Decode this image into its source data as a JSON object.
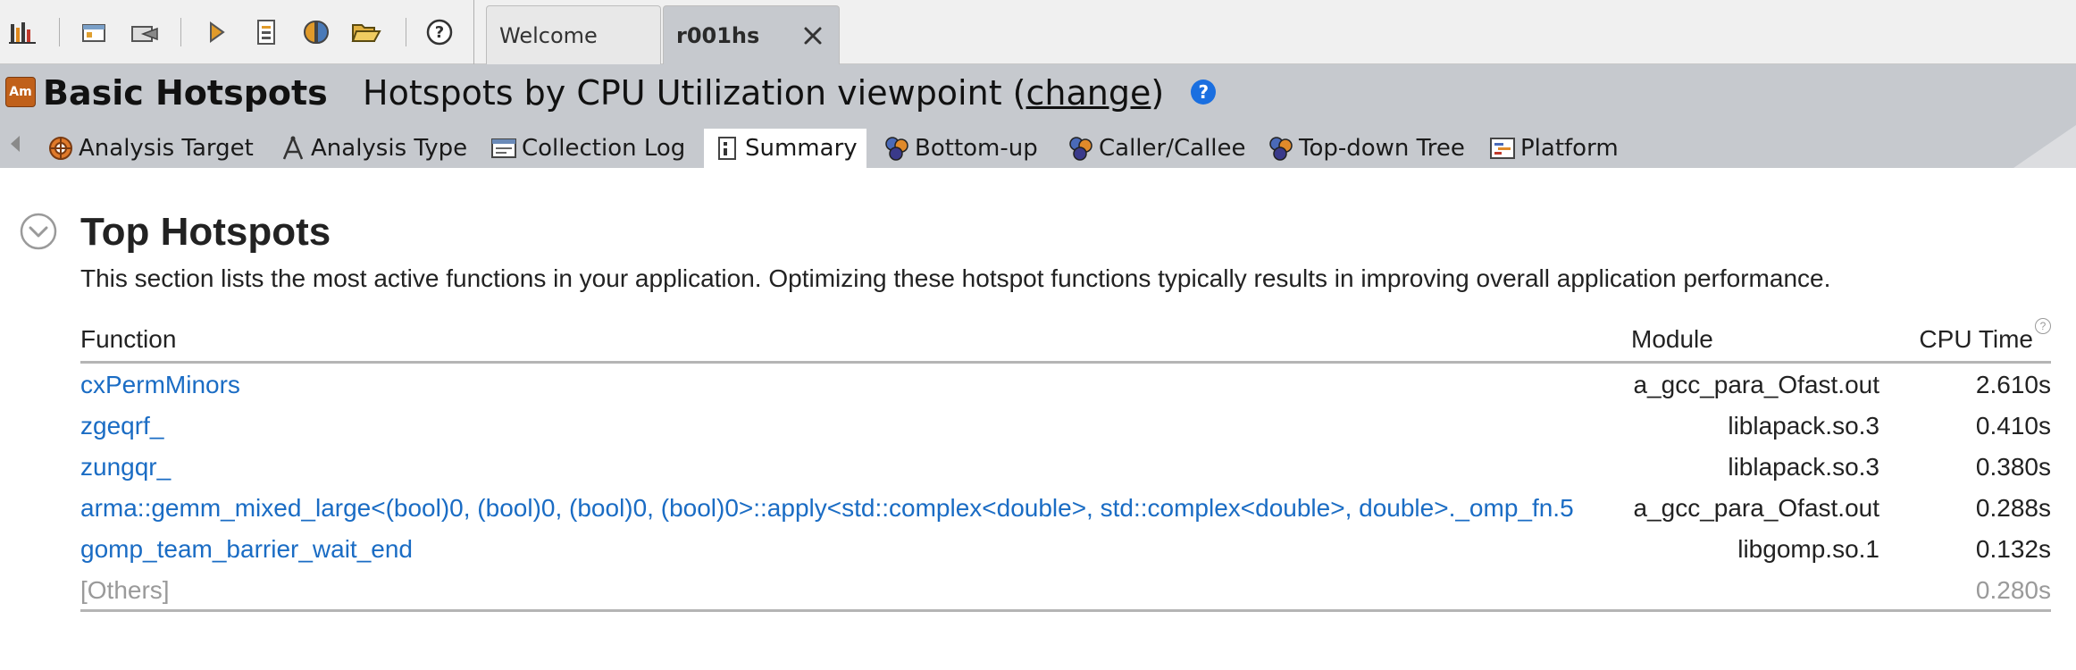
{
  "toolbar": {
    "icons": [
      "project-navigator-icon",
      "new-project-icon",
      "open-project-icon",
      "new-analysis-icon",
      "open-result-icon",
      "compare-results-icon",
      "open-file-icon",
      "help-icon"
    ]
  },
  "doc_tabs": [
    {
      "label": "Welcome",
      "active": false
    },
    {
      "label": "r001hs",
      "active": true
    }
  ],
  "header": {
    "app_badge": "Am",
    "analysis_title": "Basic Hotspots",
    "viewpoint_prefix": "Hotspots by CPU Utilization viewpoint (",
    "viewpoint_link": "change",
    "viewpoint_suffix": ")",
    "help_glyph": "?"
  },
  "view_tabs": [
    {
      "label": "Analysis Target",
      "icon": "target-icon"
    },
    {
      "label": "Analysis Type",
      "icon": "compass-icon"
    },
    {
      "label": "Collection Log",
      "icon": "log-icon"
    },
    {
      "label": "Summary",
      "icon": "summary-icon",
      "active": true
    },
    {
      "label": "Bottom-up",
      "icon": "bottom-up-icon"
    },
    {
      "label": "Caller/Callee",
      "icon": "caller-callee-icon"
    },
    {
      "label": "Top-down Tree",
      "icon": "top-down-icon"
    },
    {
      "label": "Platform",
      "icon": "platform-icon"
    }
  ],
  "section": {
    "title": "Top Hotspots",
    "description": "This section lists the most active functions in your application. Optimizing these hotspot functions typically results in improving overall application performance."
  },
  "table": {
    "columns": {
      "function": "Function",
      "module": "Module",
      "cpu_time": "CPU Time",
      "cpu_help": "?"
    },
    "rows": [
      {
        "function": "cxPermMinors",
        "module": "a_gcc_para_Ofast.out",
        "cpu_time": "2.610s"
      },
      {
        "function": "zgeqrf_",
        "module": "liblapack.so.3",
        "cpu_time": "0.410s"
      },
      {
        "function": "zungqr_",
        "module": "liblapack.so.3",
        "cpu_time": "0.380s"
      },
      {
        "function": "arma::gemm_mixed_large<(bool)0, (bool)0, (bool)0, (bool)0>::apply<std::complex<double>, std::complex<double>, double>._omp_fn.5",
        "module": "a_gcc_para_Ofast.out",
        "cpu_time": "0.288s"
      },
      {
        "function": "gomp_team_barrier_wait_end",
        "module": "libgomp.so.1",
        "cpu_time": "0.132s"
      }
    ],
    "others": {
      "function": "[Others]",
      "module": "",
      "cpu_time": "0.280s"
    }
  },
  "colors": {
    "link": "#1a6cc4",
    "header_bg": "#c6c9ce",
    "toolbar_bg": "#f0f0f0",
    "muted": "#9a9a9a",
    "help_blue": "#1a6fe0"
  }
}
